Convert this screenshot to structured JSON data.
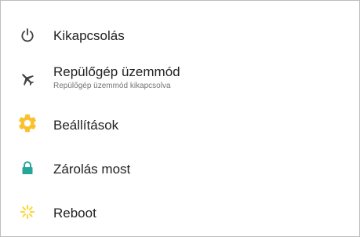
{
  "menu": {
    "items": [
      {
        "id": "power",
        "label": "Kikapcsolás",
        "icon": "power-icon",
        "icon_color": "#424242"
      },
      {
        "id": "airplane",
        "label": "Repülőgép üzemmód",
        "sublabel": "Repülőgép üzemmód kikapcsolva",
        "icon": "airplane-icon",
        "icon_color": "#424242"
      },
      {
        "id": "settings",
        "label": "Beállítások",
        "icon": "settings-gear-icon",
        "icon_color": "#fbc02d"
      },
      {
        "id": "lock",
        "label": "Zárolás most",
        "icon": "lock-icon",
        "icon_color": "#26a69a"
      },
      {
        "id": "reboot",
        "label": "Reboot",
        "icon": "reboot-icon",
        "icon_color": "#fdd835"
      }
    ]
  }
}
